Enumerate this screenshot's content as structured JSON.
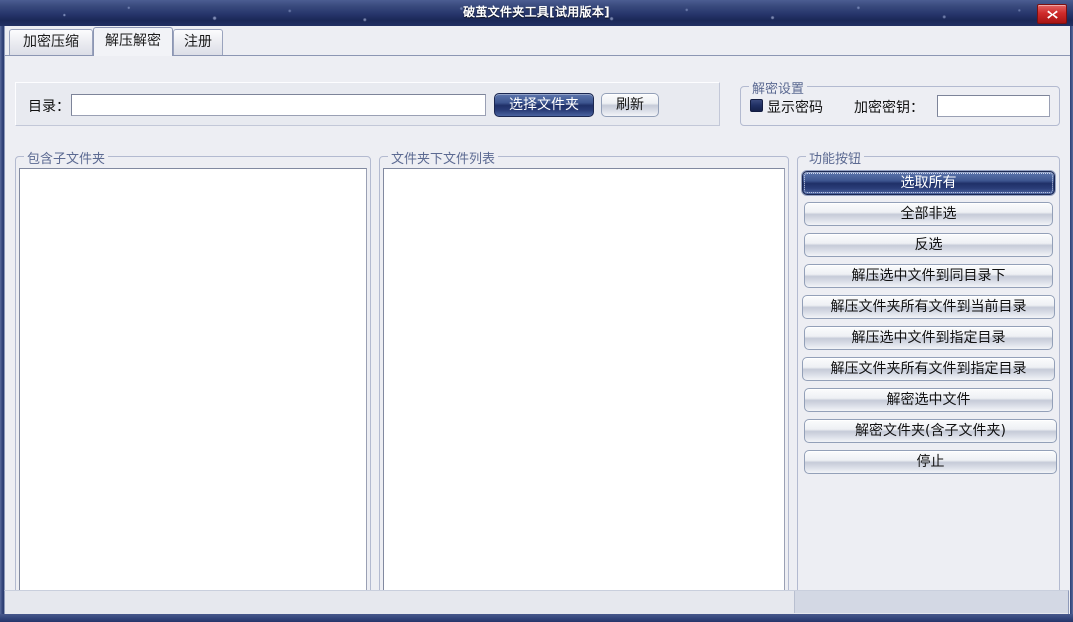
{
  "window": {
    "title": "破茧文件夹工具[试用版本]",
    "close_icon": "close-icon"
  },
  "tabs": [
    {
      "label": "加密压缩",
      "active": false
    },
    {
      "label": "解压解密",
      "active": true
    },
    {
      "label": "注册",
      "active": false
    }
  ],
  "directory_bar": {
    "label": "目录：",
    "input_value": "",
    "input_placeholder": "",
    "choose_folder_button": "选择文件夹",
    "refresh_button": "刷新"
  },
  "decrypt_settings": {
    "title": "解密设置",
    "show_password_label": "显示密码",
    "show_password_checked": true,
    "key_label": "加密密钥：",
    "key_value": "",
    "key_placeholder": ""
  },
  "subfolder_group": {
    "title": "包含子文件夹",
    "items": []
  },
  "filelist_group": {
    "title": "文件夹下文件列表",
    "items": []
  },
  "function_group": {
    "title": "功能按钮",
    "buttons": [
      {
        "label": "选取所有",
        "style": "dark"
      },
      {
        "label": "全部非选",
        "style": "light"
      },
      {
        "label": "反选",
        "style": "light"
      },
      {
        "label": "解压选中文件到同目录下",
        "style": "light"
      },
      {
        "label": "解压文件夹所有文件到当前目录",
        "style": "light"
      },
      {
        "label": "解压选中文件到指定目录",
        "style": "light"
      },
      {
        "label": "解压文件夹所有文件到指定目录",
        "style": "light"
      },
      {
        "label": "解密选中文件",
        "style": "light"
      },
      {
        "label": "解密文件夹(含子文件夹)",
        "style": "light"
      },
      {
        "label": "停止",
        "style": "light"
      }
    ]
  },
  "statusbar": {
    "pane1": "",
    "pane2": ""
  },
  "colors": {
    "title_bar": "#26356b",
    "accent_dark_button": "#2a3d78",
    "panel_bg": "#edeef3",
    "group_title": "#5c6a92",
    "close_red": "#cf2b2b"
  }
}
